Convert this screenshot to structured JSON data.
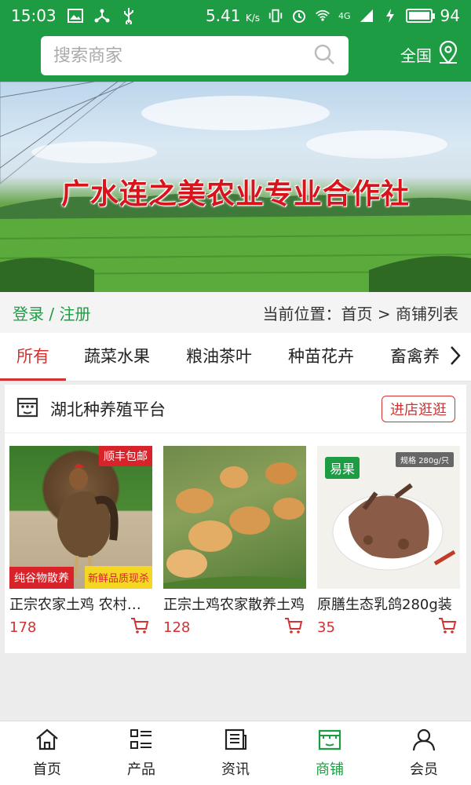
{
  "status_bar": {
    "time": "15:03",
    "speed": "5.41",
    "speed_unit": "K/s",
    "network": "4G",
    "battery": "94",
    "battery_level": 0.94
  },
  "header": {
    "search_placeholder": "搜索商家",
    "region": "全国"
  },
  "banner": {
    "title": "广水连之美农业专业合作社"
  },
  "location": {
    "login": "登录",
    "separator": " / ",
    "register": "注册",
    "position_label": "当前位置：",
    "home": "首页",
    "arrow": " > ",
    "current": "商铺列表"
  },
  "tabs": [
    {
      "label": "所有",
      "active": true
    },
    {
      "label": "蔬菜水果",
      "active": false
    },
    {
      "label": "粮油茶叶",
      "active": false
    },
    {
      "label": "种苗花卉",
      "active": false
    },
    {
      "label": "畜禽养殖",
      "active": false
    }
  ],
  "store": {
    "name": "湖北种养殖平台",
    "visit_label": "进店逛逛"
  },
  "products": [
    {
      "name": "正宗农家土鸡 农村散养",
      "price": "178",
      "badge_top": "顺丰包邮",
      "badge_left": "纯谷物散养",
      "badge_right": "新鲜品质现杀"
    },
    {
      "name": "正宗土鸡农家散养土鸡",
      "price": "128"
    },
    {
      "name": "原膳生态乳鸽280g装",
      "price": "35",
      "brand": "易果",
      "spec": "规格 280g/只"
    }
  ],
  "bottom_nav": [
    {
      "label": "首页",
      "icon": "home-icon",
      "active": false
    },
    {
      "label": "产品",
      "icon": "list-icon",
      "active": false
    },
    {
      "label": "资讯",
      "icon": "news-icon",
      "active": false
    },
    {
      "label": "商铺",
      "icon": "shop-icon",
      "active": true
    },
    {
      "label": "会员",
      "icon": "user-icon",
      "active": false
    }
  ],
  "colors": {
    "brand_green": "#1e9c44",
    "accent_red": "#d23232"
  }
}
